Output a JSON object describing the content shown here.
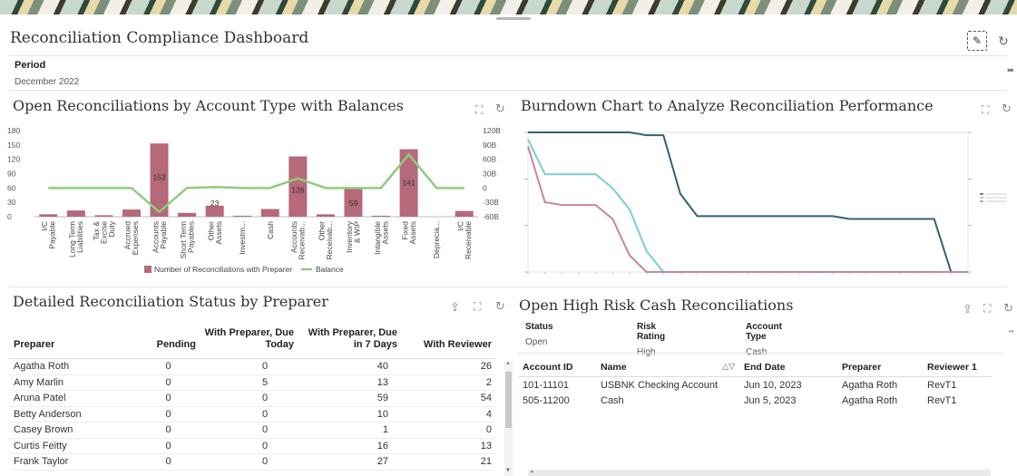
{
  "dashboard": {
    "title": "Reconciliation Compliance Dashboard",
    "period_label": "Period",
    "period_value": "December 2022",
    "more_icon": "more-horizontal-icon"
  },
  "open_recs": {
    "title": "Open Reconciliations by Account Type with Balances",
    "legend": [
      "Number of Reconciliations with Preparer",
      "Balance"
    ]
  },
  "burndown": {
    "title": "Burndown Chart to Analyze Reconciliation Performance"
  },
  "chart_data": [
    {
      "type": "bar",
      "categories": [
        "I/C Payable",
        "Long Term Liabilities",
        "Tax & Excise Duty",
        "Accrued Expenses",
        "Accounts Payable",
        "Short Term Payables",
        "Other Assets",
        "Investm...",
        "Cash",
        "Accounts Receivab...",
        "Other Receivab...",
        "Inventory & WIP",
        "Intangible Assets",
        "Fixed Assets",
        "Deprecia...",
        "I/C Receivable"
      ],
      "y_ticks": [
        "180",
        "150",
        "120",
        "90",
        "60",
        "30",
        "0"
      ],
      "y2_ticks": [
        "120B",
        "90B",
        "60B",
        "30B",
        "0",
        "-30B",
        "-60B"
      ],
      "ylim": [
        0,
        180
      ],
      "y2lim": [
        -60,
        120
      ],
      "series": [
        {
          "name": "Number of Reconciliations with Preparer",
          "type": "bar",
          "color": "#b5697a",
          "values": [
            5,
            13,
            3,
            15,
            153,
            8,
            23,
            2,
            16,
            126,
            5,
            59,
            2,
            141,
            0,
            12
          ],
          "labels": [
            "",
            "",
            "",
            "",
            "153",
            "",
            "23",
            "",
            "",
            "126",
            "",
            "59",
            "",
            "141",
            "",
            ""
          ]
        },
        {
          "name": "Balance",
          "type": "line",
          "color": "#8fcb7d",
          "values": [
            0,
            0,
            0,
            0,
            -50,
            0,
            2,
            0,
            0,
            20,
            0,
            0,
            0,
            70,
            0,
            0
          ]
        }
      ]
    },
    {
      "type": "line",
      "series": [
        {
          "color": "#2f6473",
          "values": [
            100,
            100,
            100,
            100,
            100,
            100,
            100,
            98,
            98,
            56,
            40,
            40,
            40,
            40,
            40,
            40,
            40,
            40,
            40,
            38,
            38,
            38,
            38,
            38,
            38,
            0,
            0
          ]
        },
        {
          "color": "#79cdd3",
          "values": [
            95,
            70,
            70,
            70,
            70,
            60,
            45,
            15,
            0,
            0,
            0,
            0,
            0,
            0,
            0,
            0,
            0,
            0,
            0,
            0,
            0,
            0,
            0,
            0,
            0,
            0,
            0
          ]
        },
        {
          "color": "#c98696",
          "values": [
            90,
            50,
            48,
            48,
            48,
            38,
            12,
            0,
            0,
            0,
            0,
            0,
            0,
            0,
            0,
            0,
            0,
            0,
            0,
            0,
            0,
            0,
            0,
            0,
            0,
            0,
            0
          ]
        }
      ]
    }
  ],
  "preparer_status": {
    "title": "Detailed Reconciliation Status by Preparer",
    "headers": [
      "Preparer",
      "Pending",
      "With Preparer, Due Today",
      "With Preparer, Due in 7 Days",
      "With Reviewer"
    ],
    "rows": [
      [
        "Agatha Roth",
        "0",
        "0",
        "40",
        "26"
      ],
      [
        "Amy Marlin",
        "0",
        "5",
        "13",
        "2"
      ],
      [
        "Aruna Patel",
        "0",
        "0",
        "59",
        "54"
      ],
      [
        "Betty Anderson",
        "0",
        "0",
        "10",
        "4"
      ],
      [
        "Casey Brown",
        "0",
        "0",
        "1",
        "0"
      ],
      [
        "Curtis Feitty",
        "0",
        "0",
        "16",
        "13"
      ],
      [
        "Frank Taylor",
        "0",
        "0",
        "27",
        "21"
      ]
    ]
  },
  "high_risk": {
    "title": "Open High Risk Cash Reconciliations",
    "filters": [
      {
        "label": "Status",
        "value": "Open"
      },
      {
        "label": "Risk Rating",
        "value": "High"
      },
      {
        "label": "Account Type",
        "value": "Cash"
      }
    ],
    "headers": [
      "Account ID",
      "Name",
      "End Date",
      "Preparer",
      "Reviewer 1"
    ],
    "rows": [
      [
        "101-11101",
        "USBNK Checking Account",
        "Jun 10, 2023",
        "Agatha Roth",
        "RevT1"
      ],
      [
        "505-11200",
        "Cash",
        "Jun 5, 2023",
        "Agatha Roth",
        "RevT1"
      ]
    ]
  }
}
